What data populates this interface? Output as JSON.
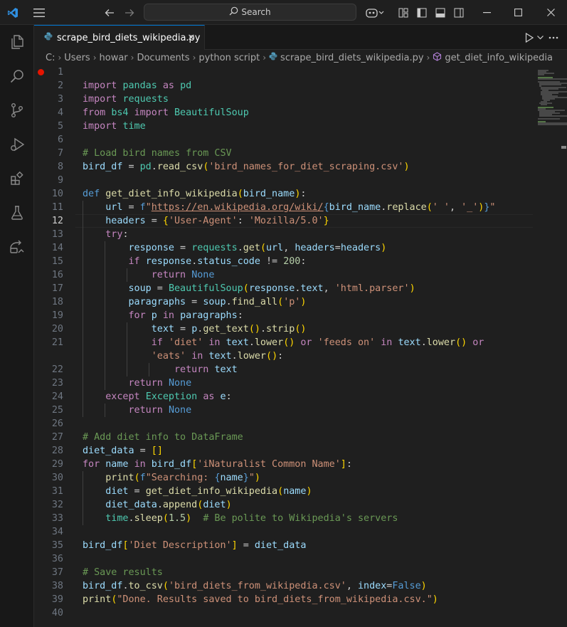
{
  "titlebar": {
    "search_label": "Search",
    "icons": [
      "vscode-logo-icon",
      "menu-icon",
      "back-arrow-icon",
      "forward-arrow-icon",
      "copilot-icon",
      "layout-icon",
      "toggle-primary-sidebar-icon",
      "toggle-panel-icon",
      "toggle-secondary-sidebar-icon",
      "minimize-icon",
      "maximize-icon",
      "close-icon"
    ]
  },
  "activitybar": {
    "icons": [
      "explorer-icon",
      "search-icon",
      "source-control-icon",
      "run-debug-icon",
      "extensions-icon",
      "testing-icon",
      "remote-explorer-icon"
    ]
  },
  "tab": {
    "label": "scrape_bird_diets_wikipedia.py",
    "close": "✕",
    "icon": "python-file-icon"
  },
  "breadcrumbs": {
    "items": [
      "C:",
      "Users",
      "howar",
      "Documents",
      "python script",
      "scrape_bird_diets_wikipedia.py",
      "get_diet_info_wikipedia"
    ],
    "separator": "›"
  },
  "editor": {
    "active_line": 12,
    "breakpoint_line": 1,
    "accent_color": "#0078d4",
    "line_numbers": [
      "1",
      "2",
      "3",
      "4",
      "5",
      "6",
      "7",
      "8",
      "9",
      "10",
      "11",
      "12",
      "13",
      "14",
      "15",
      "16",
      "17",
      "18",
      "19",
      "20",
      "21",
      "",
      "22",
      "23",
      "24",
      "25",
      "26",
      "27",
      "28",
      "29",
      "30",
      "31",
      "32",
      "33",
      "34",
      "35",
      "36",
      "37",
      "38",
      "39",
      "40"
    ],
    "code_lines": [
      "",
      "import pandas as pd",
      "import requests",
      "from bs4 import BeautifulSoup",
      "import time",
      "",
      "# Load bird names from CSV",
      "bird_df = pd.read_csv('bird_names_for_diet_scraping.csv')",
      "",
      "def get_diet_info_wikipedia(bird_name):",
      "    url = f\"https://en.wikipedia.org/wiki/{bird_name.replace(' ', '_')}\"",
      "    headers = {'User-Agent': 'Mozilla/5.0'}",
      "    try:",
      "        response = requests.get(url, headers=headers)",
      "        if response.status_code != 200:",
      "            return None",
      "        soup = BeautifulSoup(response.text, 'html.parser')",
      "        paragraphs = soup.find_all('p')",
      "        for p in paragraphs:",
      "            text = p.get_text().strip()",
      "            if 'diet' in text.lower() or 'feeds on' in text.lower() or",
      "            'eats' in text.lower():",
      "                return text",
      "        return None",
      "    except Exception as e:",
      "        return None",
      "",
      "# Add diet info to DataFrame",
      "diet_data = []",
      "for name in bird_df['iNaturalist Common Name']:",
      "    print(f\"Searching: {name}\")",
      "    diet = get_diet_info_wikipedia(name)",
      "    diet_data.append(diet)",
      "    time.sleep(1.5)  # Be polite to Wikipedia's servers",
      "",
      "bird_df['Diet Description'] = diet_data",
      "",
      "# Save results",
      "bird_df.to_csv('bird_diets_from_wikipedia.csv', index=False)",
      "print(\"Done. Results saved to bird_diets_from_wikipedia.csv.\")",
      ""
    ]
  }
}
